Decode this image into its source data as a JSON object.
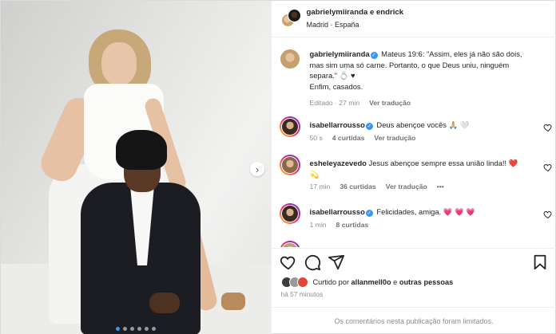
{
  "header": {
    "authors": "gabrielymiiranda e endrick",
    "location": "Madrid · España"
  },
  "caption": {
    "username": "gabrielymiiranda",
    "text_line1": " Mateus 19:6: \"Assim, eles já não são dois,",
    "text_line2": "mas sim uma só carne. Portanto, o que Deus uniu, ninguém",
    "text_line3": "separa.\" 💍 ♥",
    "text_line4": "Enfim, casados.",
    "edited": "Editado · 27 min",
    "see_translation": "Ver tradução"
  },
  "comments": [
    {
      "username": "isabellarrousso",
      "text": " Deus abençoe vocês 🙏🏼 🤍",
      "time": "50 s",
      "likes": "4 curtidas",
      "see_translation": "Ver tradução"
    },
    {
      "username": "esheleyazevedo",
      "text_line1": " Jesus abençoe sempre essa união linda!! ❤️",
      "text_line2": "💫",
      "time": "17 min",
      "likes": "36 curtidas",
      "see_translation": "Ver tradução",
      "more": "•••"
    },
    {
      "username": "isabellarrousso",
      "text": " Felicidades, amiga. 💗 💗 💗",
      "time": "1 min",
      "likes": "8 curtidas"
    }
  ],
  "likes_line": {
    "prefix": "Curtido por ",
    "user": "allanmell0o",
    "middle": " e ",
    "others": "outras pessoas"
  },
  "timestamp": "há 57 minutos",
  "comments_limited": "Os comentários nesta publicação foram limitados.",
  "carousel": {
    "total_slides": 6,
    "active_index": 0
  },
  "colors": {
    "verified": "#3897f0",
    "secondary_text": "#8e8e8e",
    "border": "#dbdbdb"
  }
}
